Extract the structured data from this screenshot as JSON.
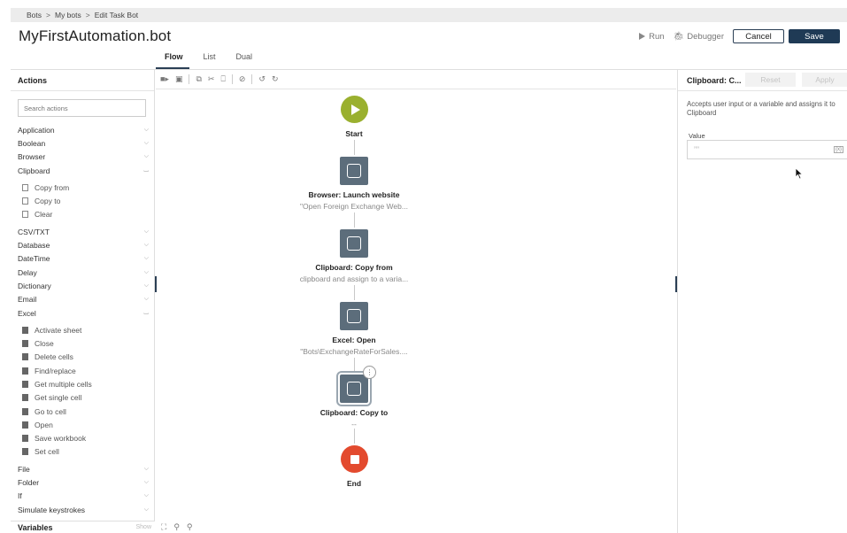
{
  "breadcrumb": [
    "Bots",
    "My bots",
    "Edit Task Bot"
  ],
  "breadcrumb_sep": ">",
  "title": "MyFirstAutomation.bot",
  "header": {
    "run_label": "Run",
    "debugger_label": "Debugger",
    "cancel_label": "Cancel",
    "save_label": "Save"
  },
  "tabs": [
    {
      "label": "Flow",
      "active": true
    },
    {
      "label": "List",
      "active": false
    },
    {
      "label": "Dual",
      "active": false
    }
  ],
  "actions": {
    "title": "Actions",
    "search_placeholder": "Search actions",
    "categories_top": [
      {
        "label": "Application",
        "expanded": false
      },
      {
        "label": "Boolean",
        "expanded": false
      },
      {
        "label": "Browser",
        "expanded": false
      },
      {
        "label": "Clipboard",
        "expanded": true
      }
    ],
    "clipboard_items": [
      "Copy from",
      "Copy to",
      "Clear"
    ],
    "categories_mid": [
      {
        "label": "CSV/TXT",
        "expanded": false
      },
      {
        "label": "Database",
        "expanded": false
      },
      {
        "label": "DateTime",
        "expanded": false
      },
      {
        "label": "Delay",
        "expanded": false
      },
      {
        "label": "Dictionary",
        "expanded": false
      },
      {
        "label": "Email",
        "expanded": false
      },
      {
        "label": "Excel",
        "expanded": true
      }
    ],
    "excel_items": [
      "Activate sheet",
      "Close",
      "Delete cells",
      "Find/replace",
      "Get multiple cells",
      "Get single cell",
      "Go to cell",
      "Open",
      "Save workbook",
      "Set cell"
    ],
    "categories_bottom": [
      {
        "label": "File",
        "expanded": false
      },
      {
        "label": "Folder",
        "expanded": false
      },
      {
        "label": "If",
        "expanded": false
      },
      {
        "label": "Simulate keystrokes",
        "expanded": false
      }
    ]
  },
  "variables": {
    "title": "Variables",
    "show_label": "Show"
  },
  "flow": {
    "start_label": "Start",
    "end_label": "End",
    "nodes": [
      {
        "title": "Browser: Launch website",
        "subtitle": "\"Open Foreign Exchange Web..."
      },
      {
        "title": "Clipboard: Copy from",
        "subtitle": "clipboard and assign to a varia..."
      },
      {
        "title": "Excel: Open",
        "subtitle": "\"Bots\\ExchangeRateForSales...."
      },
      {
        "title": "Clipboard: Copy to",
        "subtitle": "--"
      }
    ]
  },
  "properties": {
    "title": "Clipboard: C...",
    "reset_label": "Reset",
    "apply_label": "Apply",
    "description": "Accepts user input or a variable and assigns it to Clipboard",
    "value_label": "Value",
    "value_quote": "””",
    "value_var_icon": "{x}"
  },
  "colors": {
    "accent": "#1f3a55",
    "start": "#9ab02f",
    "end": "#e34a2e",
    "node": "#5c6d7b"
  }
}
